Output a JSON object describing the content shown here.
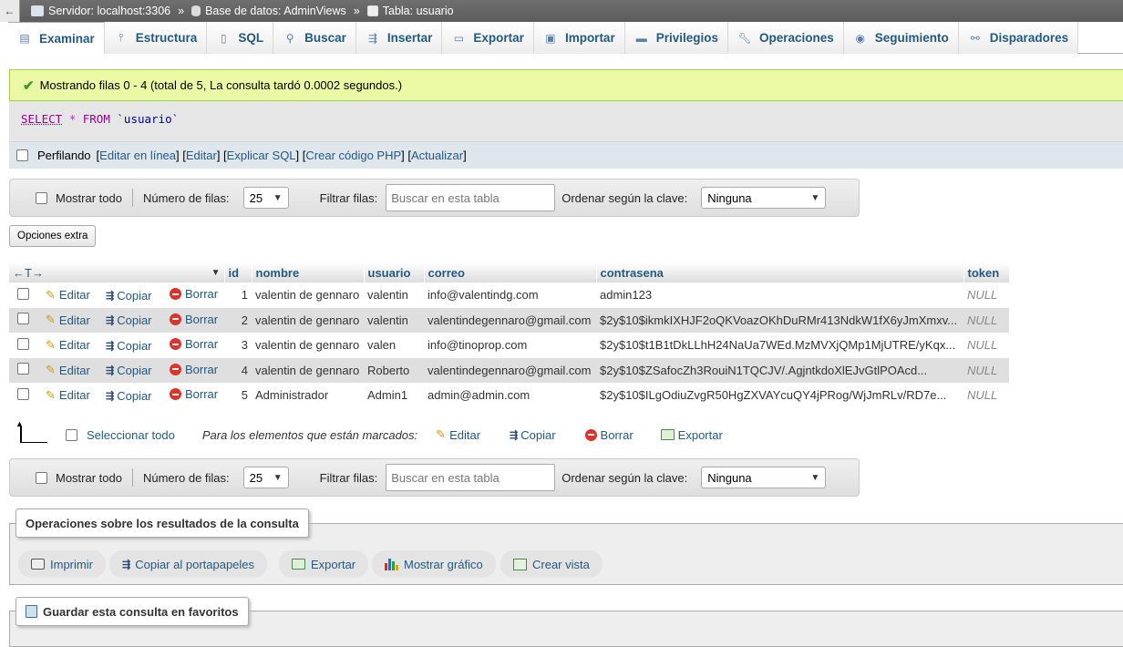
{
  "breadcrumb": {
    "server": "Servidor: localhost:3306",
    "database": "Base de datos: AdminViews",
    "table": "Tabla: usuario",
    "separator": "»"
  },
  "tabs": [
    {
      "label": "Examinar",
      "icon": "browse-icon",
      "active": true
    },
    {
      "label": "Estructura",
      "icon": "structure-icon"
    },
    {
      "label": "SQL",
      "icon": "sql-icon"
    },
    {
      "label": "Buscar",
      "icon": "search-icon"
    },
    {
      "label": "Insertar",
      "icon": "insert-icon"
    },
    {
      "label": "Exportar",
      "icon": "export-icon"
    },
    {
      "label": "Importar",
      "icon": "import-icon"
    },
    {
      "label": "Privilegios",
      "icon": "privileges-icon"
    },
    {
      "label": "Operaciones",
      "icon": "wrench-icon"
    },
    {
      "label": "Seguimiento",
      "icon": "eye-icon"
    },
    {
      "label": "Disparadores",
      "icon": "triggers-icon"
    }
  ],
  "message": "Mostrando filas 0 - 4 (total de 5, La consulta tardó 0.0002 segundos.)",
  "sql": {
    "select": "SELECT",
    "star": "*",
    "from": "FROM",
    "table": "`usuario`"
  },
  "profiling": {
    "label": "Perfilando",
    "links": [
      "Editar en línea",
      "Editar",
      "Explicar SQL",
      "Crear código PHP",
      "Actualizar"
    ]
  },
  "navbar": {
    "show_all": "Mostrar todo",
    "rows_label": "Número de filas:",
    "rows_value": "25",
    "filter_label": "Filtrar filas:",
    "filter_placeholder": "Buscar en esta tabla",
    "sort_label": "Ordenar según la clave:",
    "sort_value": "Ninguna"
  },
  "extra_options": "Opciones extra",
  "table": {
    "columns": [
      "id",
      "nombre",
      "usuario",
      "correo",
      "contrasena",
      "token"
    ],
    "actions": {
      "edit": "Editar",
      "copy": "Copiar",
      "delete": "Borrar"
    },
    "rows": [
      {
        "id": "1",
        "nombre": "valentin de gennaro",
        "usuario": "valentin",
        "correo": "info@valentindg.com",
        "contrasena": "admin123",
        "token": "NULL"
      },
      {
        "id": "2",
        "nombre": "valentin de gennaro",
        "usuario": "valentin",
        "correo": "valentindegennaro@gmail.com",
        "contrasena": "$2y$10$ikmkIXHJF2oQKVoazOKhDuRMr413NdkW1fX6yJmXmxv...",
        "token": "NULL"
      },
      {
        "id": "3",
        "nombre": "valentin de gennaro",
        "usuario": "valen",
        "correo": "info@tinoprop.com",
        "contrasena": "$2y$10$t1B1tDkLLhH24NaUa7WEd.MzMVXjQMp1MjUTRE/yKqx...",
        "token": "NULL"
      },
      {
        "id": "4",
        "nombre": "valentin de gennaro",
        "usuario": "Roberto",
        "correo": "valentindegennaro@gmail.com",
        "contrasena": "$2y$10$ZSafocZh3RouiN1TQCJV/.AgjntkdoXlEJvGtlPOAcd...",
        "token": "NULL"
      },
      {
        "id": "5",
        "nombre": "Administrador",
        "usuario": "Admin1",
        "correo": "admin@admin.com",
        "contrasena": "$2y$10$ILgOdiuZvgR50HgZXVAYcuQY4jPRog/WjJmRLv/RD7e...",
        "token": "NULL"
      }
    ]
  },
  "bulk": {
    "select_all": "Seleccionar todo",
    "marked_label": "Para los elementos que están marcados:",
    "edit": "Editar",
    "copy": "Copiar",
    "delete": "Borrar",
    "export": "Exportar"
  },
  "result_ops": {
    "legend": "Operaciones sobre los resultados de la consulta",
    "print": "Imprimir",
    "copy_clipboard": "Copiar al portapapeles",
    "export": "Exportar",
    "chart": "Mostrar gráfico",
    "create_view": "Crear vista"
  },
  "bookmark": {
    "legend": "Guardar esta consulta en favoritos"
  },
  "colors": {
    "link": "#235a81",
    "success_bg": "#ebf8a4",
    "null_text": "#888888",
    "delete_icon": "#d9362b"
  }
}
